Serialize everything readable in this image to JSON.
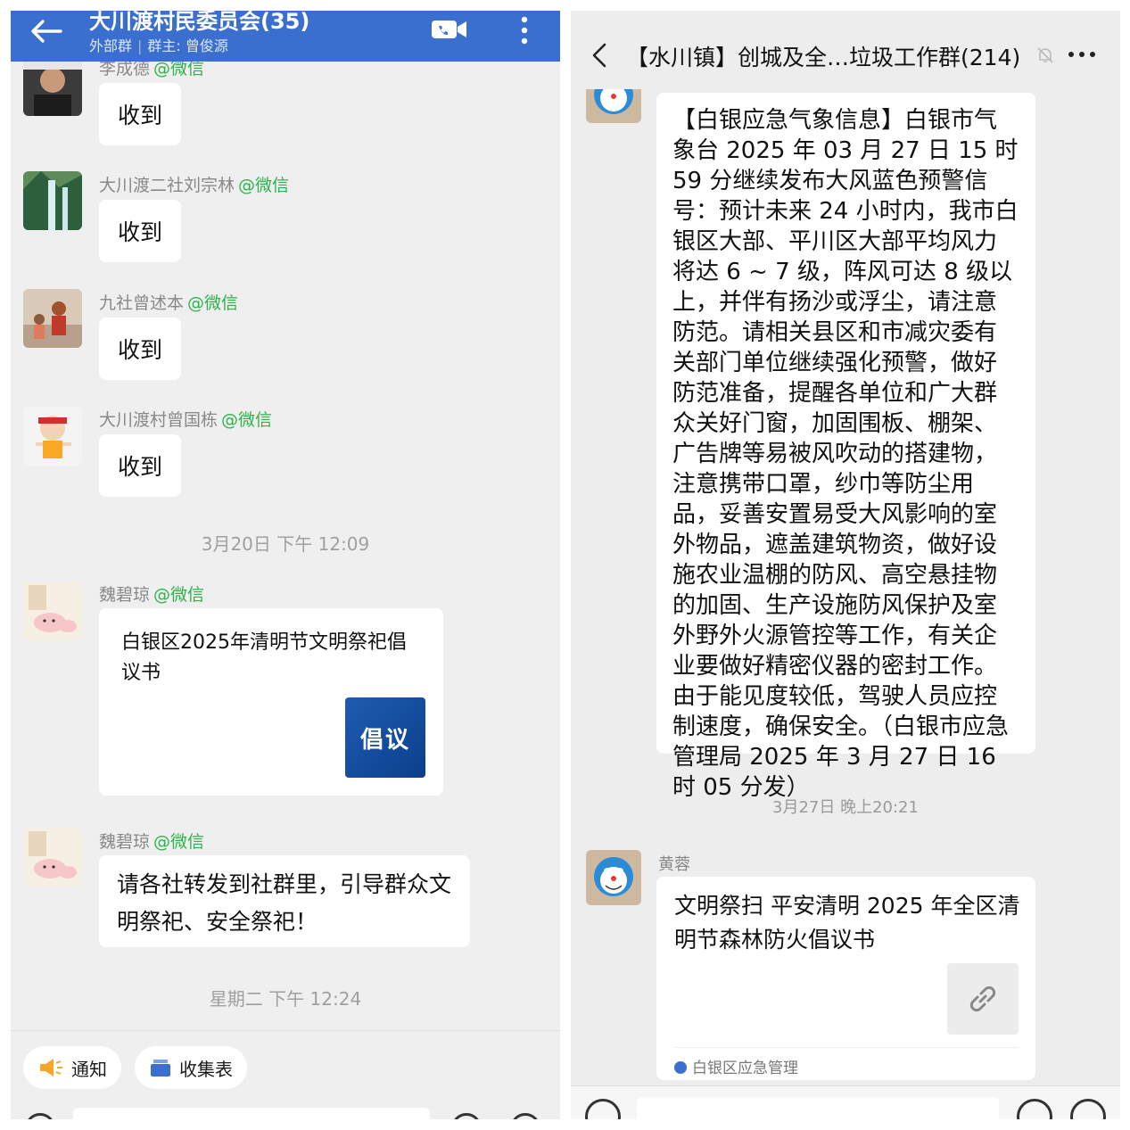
{
  "left": {
    "header": {
      "title": "大川渡村民委员会(35)",
      "subtitle_external": "外部群",
      "subtitle_owner": "群主: 曾俊源"
    },
    "messages": [
      {
        "sender": "李成德",
        "tag": "@微信",
        "text": "收到"
      },
      {
        "sender": "大川渡二社刘宗林",
        "tag": "@微信",
        "text": "收到"
      },
      {
        "sender": "九社曾述本",
        "tag": "@微信",
        "text": "收到"
      },
      {
        "sender": "大川渡村曾国栋",
        "tag": "@微信",
        "text": "收到"
      }
    ],
    "timestamp1": "3月20日  下午 12:09",
    "card_message": {
      "sender": "魏碧琼",
      "tag": "@微信",
      "title": "白银区2025年清明节文明祭祀倡议书",
      "thumb_label": "倡议"
    },
    "text_message": {
      "sender": "魏碧琼",
      "tag": "@微信",
      "text": "请各社转发到社群里，引导群众文明祭祀、安全祭祀！"
    },
    "timestamp2": "星期二  下午 12:24",
    "chips": [
      "通知",
      "收集表"
    ]
  },
  "right": {
    "header": {
      "title": "【水川镇】创城及全…垃圾工作群(214)"
    },
    "weather_message": "【白银应急气象信息】白银市气象台 2025 年 03 月 27 日 15 时 59 分继续发布大风蓝色预警信号：预计未来 24 小时内，我市白银区大部、平川区大部平均风力将达 6 ~ 7 级，阵风可达 8 级以上，并伴有扬沙或浮尘，请注意防范。请相关县区和市减灾委有关部门单位继续强化预警，做好防范准备，提醒各单位和广大群众关好门窗，加固围板、棚架、广告牌等易被风吹动的搭建物，注意携带口罩，纱巾等防尘用品，妥善安置易受大风影响的室外物品，遮盖建筑物资，做好设施农业温棚的防风、高空悬挂物的加固、生产设施防风保护及室外野外火源管控等工作，有关企业要做好精密仪器的密封工作。由于能见度较低，驾驶人员应控制速度，确保安全。（白银市应急管理局 2025 年 3 月 27 日 16 时 05 分发）",
    "timestamp": "3月27日 晚上20:21",
    "link_message": {
      "sender": "黄蓉",
      "title": "文明祭扫 平安清明 2025 年全区清明节森林防火倡议书",
      "source": "白银区应急管理"
    }
  },
  "colors": {
    "left_header": "#3a6fd0",
    "wechat_tag": "#2db34a",
    "right_background": "#ededed"
  }
}
